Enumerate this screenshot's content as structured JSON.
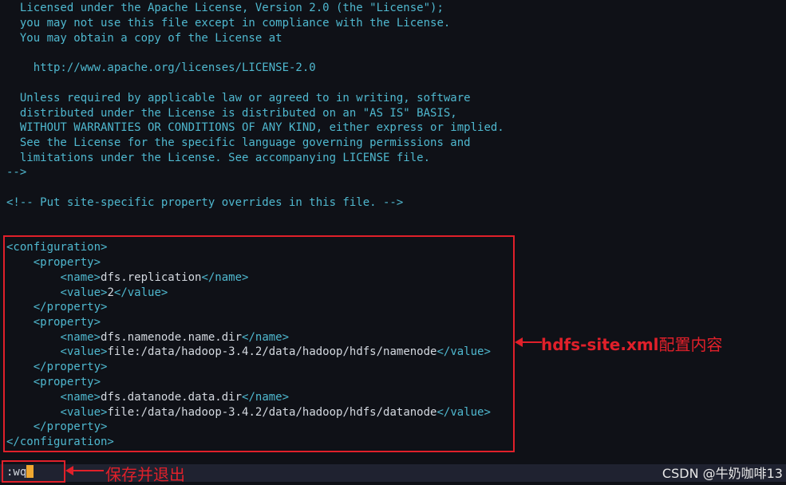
{
  "editor": {
    "license_lines": [
      "  Licensed under the Apache License, Version 2.0 (the \"License\");",
      "  you may not use this file except in compliance with the License.",
      "  You may obtain a copy of the License at",
      "",
      "    http://www.apache.org/licenses/LICENSE-2.0",
      "",
      "  Unless required by applicable law or agreed to in writing, software",
      "  distributed under the License is distributed on an \"AS IS\" BASIS,",
      "  WITHOUT WARRANTIES OR CONDITIONS OF ANY KIND, either express or implied.",
      "  See the License for the specific language governing permissions and",
      "  limitations under the License. See accompanying LICENSE file.",
      "-->"
    ],
    "site_comment": "<!-- Put site-specific property overrides in this file. -->",
    "config": {
      "config_open": "<configuration>",
      "config_close": "</configuration>",
      "property_open": "<property>",
      "property_close": "</property>",
      "name_open": "<name>",
      "name_close": "</name>",
      "value_open": "<value>",
      "value_close": "</value>",
      "properties": [
        {
          "name": "dfs.replication",
          "value": "2"
        },
        {
          "name": "dfs.namenode.name.dir",
          "value": "file:/data/hadoop-3.4.2/data/hadoop/hdfs/namenode"
        },
        {
          "name": "dfs.datanode.data.dir",
          "value": "file:/data/hadoop-3.4.2/data/hadoop/hdfs/datanode"
        }
      ]
    }
  },
  "annotations": {
    "config_label_bold": "hdfs-site.xml",
    "config_label_rest": "配置内容",
    "save_label": "保存并退出"
  },
  "command_line": {
    "text": ":wq"
  },
  "watermark": "CSDN @牛奶咖啡13",
  "colors": {
    "background": "#0f1117",
    "comment": "#4fb8cf",
    "text": "#d4d9e0",
    "annotation_red": "#e0202a",
    "cursor": "#f0a830"
  }
}
